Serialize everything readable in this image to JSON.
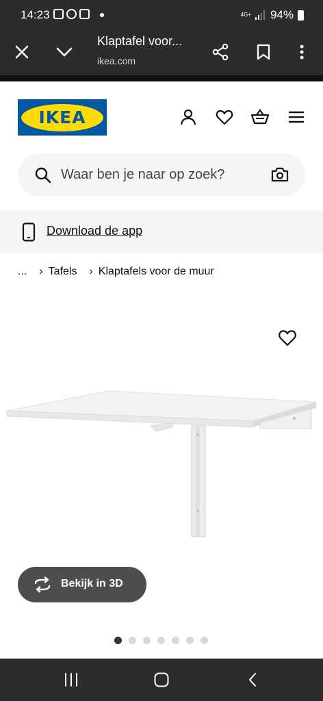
{
  "status_bar": {
    "time": "14:23",
    "network": "4G+",
    "battery": "94%"
  },
  "browser": {
    "page_title": "Klaptafel voor...",
    "domain": "ikea.com"
  },
  "header": {
    "logo_text": "IKEA"
  },
  "search": {
    "placeholder": "Waar ben je naar op zoek?"
  },
  "app_banner": {
    "label": "Download de app"
  },
  "breadcrumb": {
    "ellipsis": "...",
    "items": [
      "Tafels",
      "Klaptafels voor de muur"
    ]
  },
  "product": {
    "view_3d_label": "Bekijk in 3D",
    "gallery_count": 7,
    "gallery_active": 1
  },
  "colors": {
    "ikea_blue": "#0058a3",
    "ikea_yellow": "#ffdb00",
    "system_bar": "#2b2c2e"
  }
}
